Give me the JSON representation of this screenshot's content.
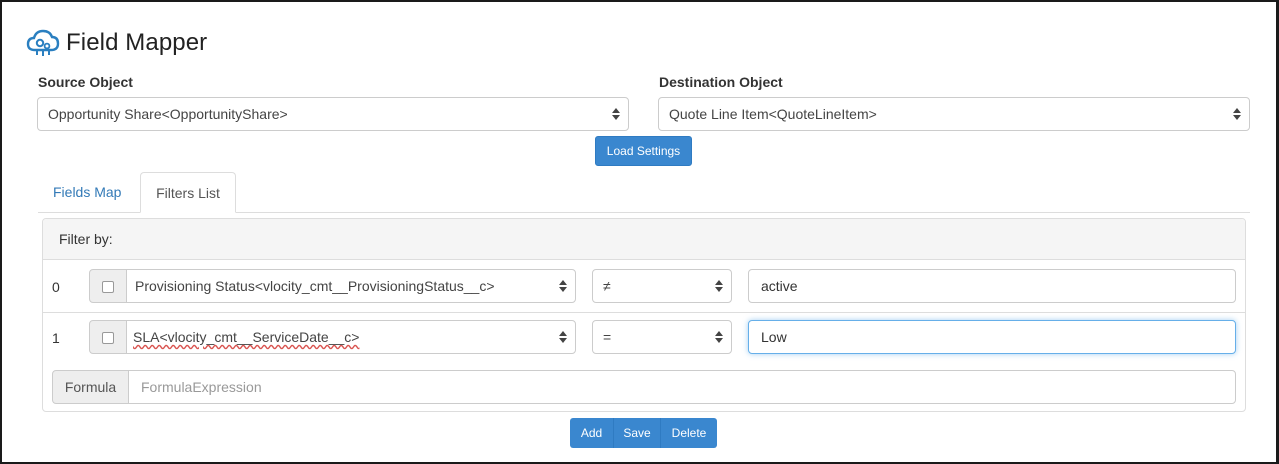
{
  "app": {
    "title": "Field Mapper",
    "logo_icon": "cloud-gears-icon",
    "accent": "#3a87cf"
  },
  "source": {
    "label": "Source Object",
    "value": "Opportunity Share<OpportunityShare>"
  },
  "destination": {
    "label": "Destination Object",
    "value": "Quote Line Item<QuoteLineItem>"
  },
  "load_settings_label": "Load Settings",
  "tabs": [
    {
      "label": "Fields Map",
      "active": false
    },
    {
      "label": "Filters List",
      "active": true
    }
  ],
  "filters": {
    "header": "Filter by:",
    "rows": [
      {
        "index": "0",
        "field": "Provisioning Status<vlocity_cmt__ProvisioningStatus__c>",
        "operator": "≠",
        "value": "active"
      },
      {
        "index": "1",
        "field": "SLA<vlocity_cmt__ServiceDate__c>",
        "operator": "=",
        "value": "Low"
      }
    ],
    "formula_label": "Formula",
    "formula_placeholder": "FormulaExpression"
  },
  "actions": {
    "add": "Add",
    "save": "Save",
    "delete": "Delete"
  }
}
